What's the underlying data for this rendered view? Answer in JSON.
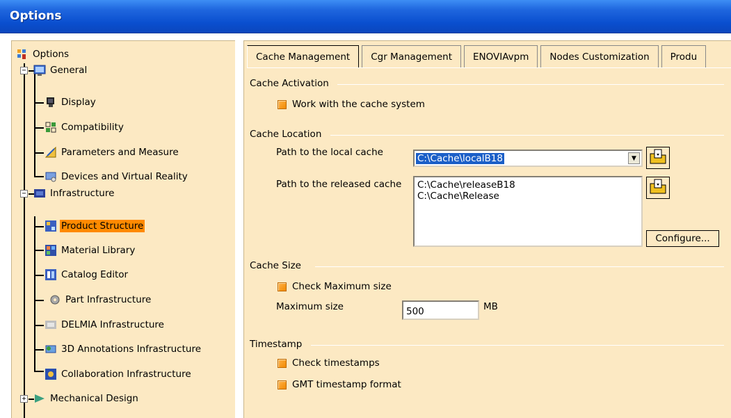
{
  "window": {
    "title": "Options"
  },
  "tree": {
    "root": "Options",
    "items": [
      {
        "label": "General"
      },
      {
        "label": "Display"
      },
      {
        "label": "Compatibility"
      },
      {
        "label": "Parameters and Measure"
      },
      {
        "label": "Devices and Virtual Reality"
      },
      {
        "label": "Infrastructure"
      },
      {
        "label": "Product Structure"
      },
      {
        "label": "Material Library"
      },
      {
        "label": "Catalog Editor"
      },
      {
        "label": "Part Infrastructure"
      },
      {
        "label": "DELMIA Infrastructure"
      },
      {
        "label": "3D Annotations Infrastructure"
      },
      {
        "label": "Collaboration Infrastructure"
      },
      {
        "label": "Mechanical Design"
      }
    ],
    "selected": "Product Structure"
  },
  "tabs": [
    {
      "label": "Cache Management"
    },
    {
      "label": "Cgr Management"
    },
    {
      "label": "ENOVIAvpm"
    },
    {
      "label": "Nodes Customization"
    },
    {
      "label": "Produ"
    }
  ],
  "cache_activation": {
    "title": "Cache Activation",
    "work_with_cache": "Work with the cache system"
  },
  "cache_location": {
    "title": "Cache Location",
    "local_label": "Path to the local cache",
    "local_value": "C:\\Cache\\localB18",
    "released_label": "Path to the released cache",
    "released_paths": [
      "C:\\Cache\\releaseB18",
      "C:\\Cache\\Release"
    ],
    "configure": "Configure..."
  },
  "cache_size": {
    "title": "Cache Size",
    "check_max": "Check Maximum size",
    "max_label": "Maximum size",
    "max_value": "500",
    "unit": "MB"
  },
  "timestamp": {
    "title": "Timestamp",
    "check": "Check timestamps",
    "gmt": "GMT timestamp format"
  },
  "colors": {
    "accent": "#ff8a00",
    "panel": "#fce9c3",
    "titlebar": "#0a4fcf"
  }
}
